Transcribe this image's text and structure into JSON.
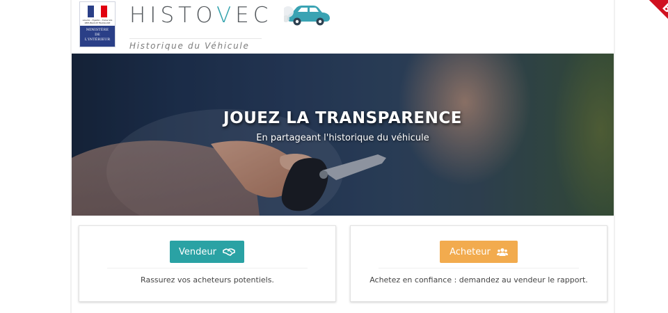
{
  "header": {
    "ministry": {
      "republic_text": "Liberté • Égalité • Fraternité RÉPUBLIQUE FRANÇAISE",
      "line1": "MINISTÈRE",
      "line2": "DE",
      "line3": "L'INTÉRIEUR"
    },
    "brand": {
      "part1": "HISTO",
      "part2": "V",
      "part3": "EC",
      "logo_icon": "car-icon"
    },
    "tagline": "Historique du Véhicule",
    "badge": "BETA"
  },
  "hero": {
    "title": "JOUEZ LA TRANSPARENCE",
    "subtitle": "En partageant l'historique du véhicule"
  },
  "cards": {
    "seller": {
      "button_label": "Vendeur",
      "button_icon": "handshake-icon",
      "text": "Rassurez vos acheteurs potentiels."
    },
    "buyer": {
      "button_label": "Acheteur",
      "button_icon": "users-icon",
      "text": "Achetez en confiance : demandez au vendeur le rapport."
    }
  },
  "colors": {
    "teal": "#2aa2a4",
    "orange": "#f2ab4e",
    "beta_red": "#d0101f",
    "brand_gray": "#555a5e"
  }
}
